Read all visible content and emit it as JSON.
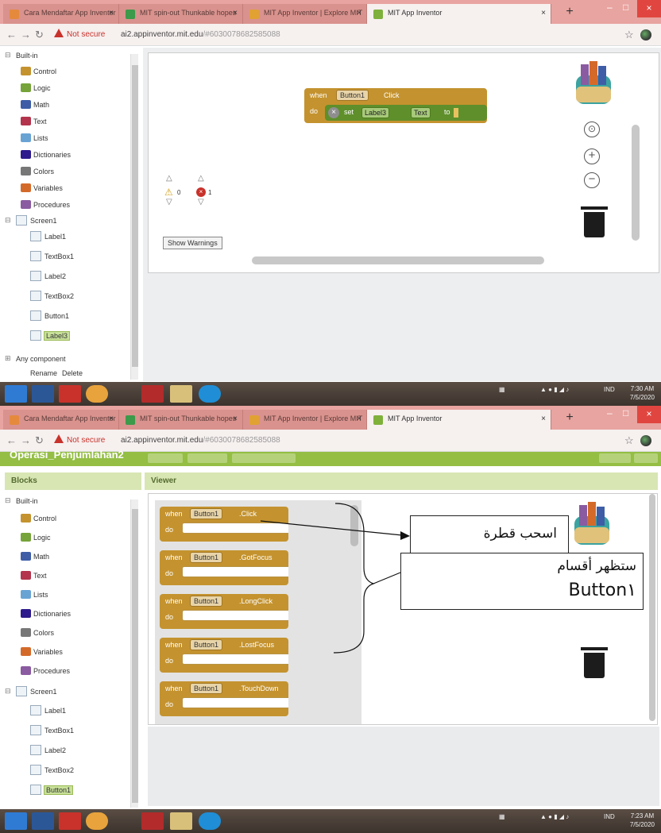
{
  "screenshot_top": {
    "tabs": [
      {
        "label": "Cara Mendaftar App Inventor",
        "color": "#e58a3d"
      },
      {
        "label": "MIT spin-out Thunkable hopes",
        "color": "#3c9a4a"
      },
      {
        "label": "MIT App Inventor | Explore MIT",
        "color": "#e1a233"
      },
      {
        "label": "MIT App Inventor",
        "color": "#7fb03b"
      }
    ],
    "address": {
      "not_secure": "Not secure",
      "url_host": "ai2.appinventor.mit.edu",
      "url_path": "/#6030078682585088"
    },
    "tree": {
      "builtin": "Built-in",
      "items": [
        {
          "label": "Control",
          "color": "#c4932f"
        },
        {
          "label": "Logic",
          "color": "#76a33a"
        },
        {
          "label": "Math",
          "color": "#3e5da6"
        },
        {
          "label": "Text",
          "color": "#b3344c"
        },
        {
          "label": "Lists",
          "color": "#69a3d4"
        },
        {
          "label": "Dictionaries",
          "color": "#2d1a8c"
        },
        {
          "label": "Colors",
          "color": "#777777"
        },
        {
          "label": "Variables",
          "color": "#d46a2a"
        },
        {
          "label": "Procedures",
          "color": "#8a5ba0"
        }
      ],
      "screen": "Screen1",
      "components": [
        "Label1",
        "TextBox1",
        "Label2",
        "TextBox2",
        "Button1",
        "Label3"
      ],
      "any_component": "Any component",
      "rename": "Rename",
      "delete": "Delete"
    },
    "event_block": {
      "when": "when",
      "component": "Button1",
      "event": "Click",
      "do": "do"
    },
    "set_block": {
      "set": "set",
      "component": "Label3",
      "property": "Text",
      "to": "to"
    },
    "warnings": {
      "warn_count": "0",
      "error_count": "1",
      "button": "Show Warnings"
    },
    "clock": {
      "time": "7:30 AM",
      "date": "7/5/2020"
    },
    "tray_lang": "IND"
  },
  "screenshot_bottom": {
    "tabs": [
      {
        "label": "Cara Mendaftar App Inventor",
        "color": "#e58a3d"
      },
      {
        "label": "MIT spin-out Thunkable hopes",
        "color": "#3c9a4a"
      },
      {
        "label": "MIT App Inventor | Explore MIT",
        "color": "#e1a233"
      },
      {
        "label": "MIT App Inventor",
        "color": "#7fb03b"
      }
    ],
    "address": {
      "not_secure": "Not secure",
      "url_host": "ai2.appinventor.mit.edu",
      "url_path": "/#6030078682585088"
    },
    "project_name": "Operasi_Penjumlahan2",
    "panels": {
      "blocks": "Blocks",
      "viewer": "Viewer"
    },
    "tree": {
      "builtin": "Built-in",
      "items": [
        {
          "label": "Control",
          "color": "#c4932f"
        },
        {
          "label": "Logic",
          "color": "#76a33a"
        },
        {
          "label": "Math",
          "color": "#3e5da6"
        },
        {
          "label": "Text",
          "color": "#b3344c"
        },
        {
          "label": "Lists",
          "color": "#69a3d4"
        },
        {
          "label": "Dictionaries",
          "color": "#2d1a8c"
        },
        {
          "label": "Colors",
          "color": "#777777"
        },
        {
          "label": "Variables",
          "color": "#d46a2a"
        },
        {
          "label": "Procedures",
          "color": "#8a5ba0"
        }
      ],
      "screen": "Screen1",
      "components": [
        "Label1",
        "TextBox1",
        "Label2",
        "TextBox2",
        "Button1"
      ]
    },
    "drawer_blocks": [
      {
        "when": "when",
        "component": "Button1",
        "event": ".Click",
        "do": "do"
      },
      {
        "when": "when",
        "component": "Button1",
        "event": ".GotFocus",
        "do": "do"
      },
      {
        "when": "when",
        "component": "Button1",
        "event": ".LongClick",
        "do": "do"
      },
      {
        "when": "when",
        "component": "Button1",
        "event": ".LostFocus",
        "do": "do"
      },
      {
        "when": "when",
        "component": "Button1",
        "event": ".TouchDown",
        "do": "do"
      }
    ],
    "callout_drag": "اسحب قطرة",
    "callout_sections": "ستظهر أقسام",
    "callout_button": "Button١",
    "clock": {
      "time": "7:23 AM",
      "date": "7/5/2020"
    },
    "tray_lang": "IND"
  },
  "colors": {
    "event": "#c4932f",
    "setter": "#5e8f2b",
    "accent_green": "#94be44"
  }
}
